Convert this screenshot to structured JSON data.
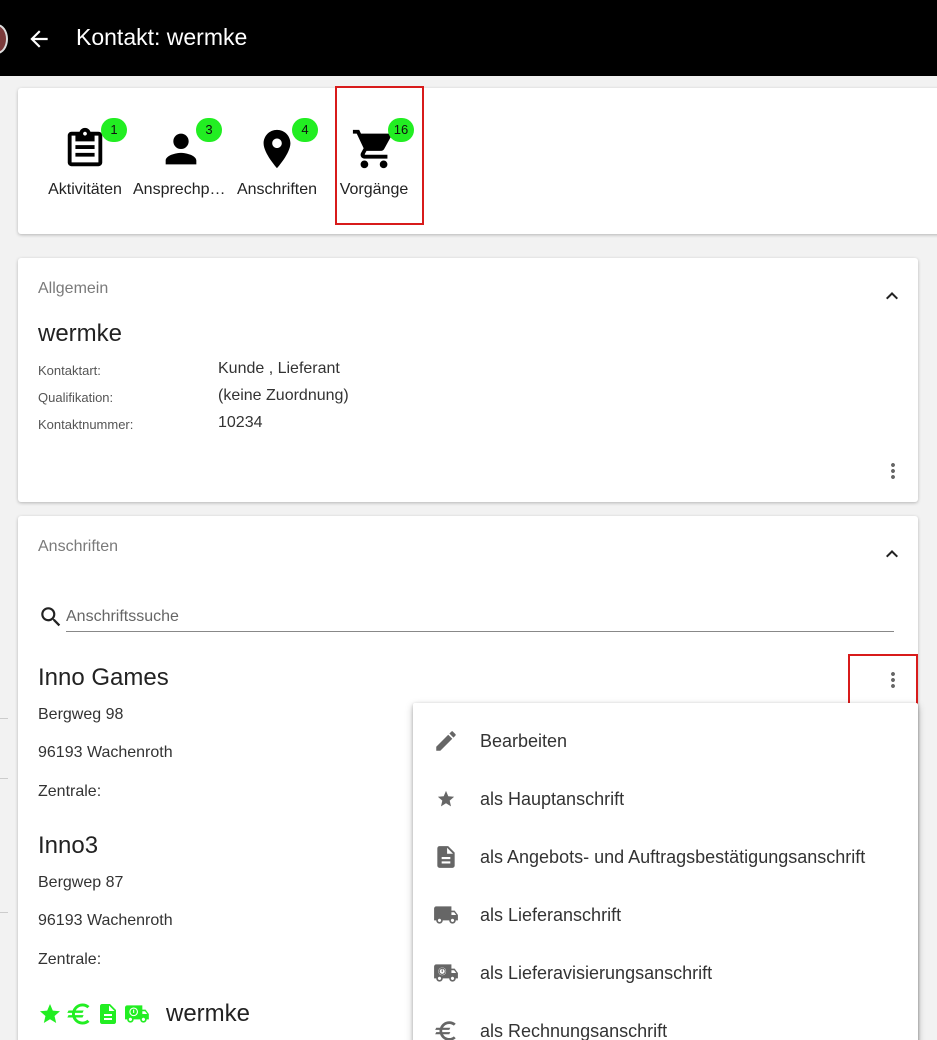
{
  "header": {
    "title": "Kontakt: wermke"
  },
  "nav": {
    "items": [
      {
        "label": "Aktivitäten",
        "badge": "1",
        "icon": "clipboard-icon"
      },
      {
        "label": "Ansprechpartner",
        "badge": "3",
        "icon": "person-icon"
      },
      {
        "label": "Anschriften",
        "badge": "4",
        "icon": "location-pin-icon"
      },
      {
        "label": "Vorgänge",
        "badge": "16",
        "icon": "shopping-cart-icon"
      }
    ]
  },
  "general": {
    "title": "Allgemein",
    "name": "wermke",
    "fields": [
      {
        "label": "Kontaktart:",
        "value": "Kunde , Lieferant"
      },
      {
        "label": "Qualifikation:",
        "value": "(keine Zuordnung)"
      },
      {
        "label": "Kontaktnummer:",
        "value": "10234"
      }
    ]
  },
  "addresses": {
    "title": "Anschriften",
    "search_placeholder": "Anschriftssuche",
    "list": [
      {
        "name": "Inno Games",
        "street": "Bergweg 98",
        "city": "96193 Wachenroth",
        "zentrale": "Zentrale:"
      },
      {
        "name": "Inno3",
        "street": "Bergwep 87",
        "city": "96193 Wachenroth",
        "zentrale": "Zentrale:"
      },
      {
        "name": "wermke"
      }
    ]
  },
  "context_menu": {
    "items": [
      {
        "label": "Bearbeiten",
        "icon": "pencil-icon"
      },
      {
        "label": "als Hauptanschrift",
        "icon": "star-icon"
      },
      {
        "label": "als Angebots- und Auftragsbestätigungsanschrift",
        "icon": "document-icon"
      },
      {
        "label": "als Lieferanschrift",
        "icon": "truck-icon"
      },
      {
        "label": "als Lieferavisierungsanschrift",
        "icon": "truck-notice-icon"
      },
      {
        "label": "als Rechnungsanschrift",
        "icon": "euro-icon"
      }
    ]
  },
  "colors": {
    "badge": "#22ee22",
    "highlight": "#d81b1b",
    "tag": "#22ee22",
    "header": "#000000"
  }
}
